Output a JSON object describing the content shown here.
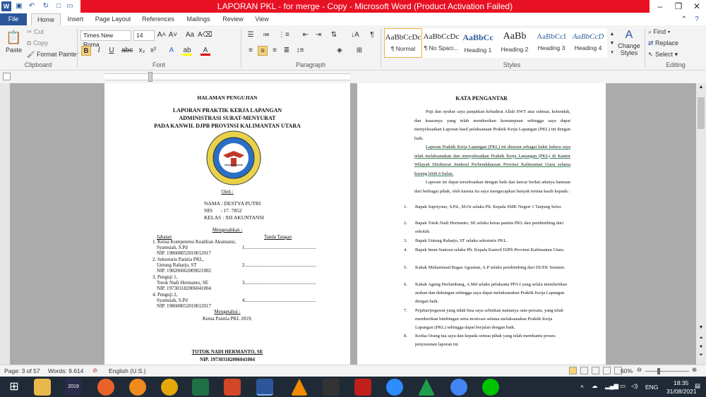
{
  "window": {
    "title": "LAPORAN PKL - for merge - Copy  -  Microsoft Word (Product Activation Failed)"
  },
  "tabs": [
    "File",
    "Home",
    "Insert",
    "Page Layout",
    "References",
    "Mailings",
    "Review",
    "View"
  ],
  "clipboard": {
    "paste": "Paste",
    "cut": "Cut",
    "copy": "Copy",
    "format_painter": "Format Painter",
    "label": "Clipboard"
  },
  "font": {
    "name": "Times New Roma",
    "size": "14",
    "label": "Font"
  },
  "paragraph": {
    "label": "Paragraph"
  },
  "styles": {
    "items": [
      {
        "preview": "AaBbCcDc",
        "name": "¶ Normal"
      },
      {
        "preview": "AaBbCcDc",
        "name": "¶ No Spaci..."
      },
      {
        "preview": "AaBbCc",
        "name": "Heading 1"
      },
      {
        "preview": "AaBb",
        "name": "Heading 2"
      },
      {
        "preview": "AaBbCcI",
        "name": "Heading 3"
      },
      {
        "preview": "AaBbCcD",
        "name": "Heading 4"
      }
    ],
    "change": "Change Styles",
    "label": "Styles"
  },
  "editing": {
    "find": "Find",
    "replace": "Replace",
    "select": "Select",
    "label": "Editing"
  },
  "page1": {
    "h1": "HALAMAN PENGUJIAN",
    "t1": "LAPORAN PRAKTIK  KERJA LAPANGAN",
    "t2": "ADMINISTRASI  SURAT-MENYURAT",
    "t3": "PADA KANWIL  DJPB PROVINSI KALIMANTAN  UTARA",
    "oleh": "Oleh :",
    "nama": "NAMA : DESTYA PUTRI",
    "nis": "NIS      : 17. 7852",
    "kelas": "KELAS : XII AKUNTANSI",
    "mengesahkan": "Mengesahkan :",
    "jabatan": "Jabatan",
    "tanda": "Tanda Tangan",
    "rows": [
      {
        "a": "1. Ketua Kompetensi Keahlian Akuntansi,",
        "b": "Syamsiah, S.Pd",
        "c": "NIP. 198608052010012017",
        "d": "1.........................................................."
      },
      {
        "a": "2. Sekretaris Panitia PKL,",
        "b": "Untung Raharjo, ST",
        "c": "NIP. 198206062009021002",
        "d": "2.........................................................."
      },
      {
        "a": "3. Penguji 1,",
        "b": "Totok Nadi Hermanto, SE",
        "c": "NIP. 197303182006041004",
        "d": "3.........................................................."
      },
      {
        "a": "4. Penguji 2,",
        "b": "Syamsiah, S.Pd",
        "c": "NIP. 198608052010012017",
        "d": "4.........................................................."
      }
    ],
    "mengetahui": "Mengetahui :",
    "ketua": "Ketua Panitia PKL 2019,",
    "sign_name": "TOTOK NADI HERMANTO, SE",
    "sign_nip": "NIP. 197303182006041004"
  },
  "page2": {
    "title": "KATA PENGANTAR",
    "p1": "Puji dan syukur saya panjatkan kehadirat Allah SWT atas rahmat, kehendak, dan kuasanya yang telah memberikan kemampuan sehingga saya dapat menyelesaikan Laporan hasil pelaksanaan Praktik Kerja Lapangan (PKL) ini dengan baik.",
    "p2": "Laporan Praktik Kerja Lapangan (PKL) ini disusun sebagai bukti bahwa saya telah melaksanakan dan menyelesaikan Praktik Kerja Lapangan (PKL) di Kantor Wilayah Direktorat Jenderal Perbendaharaan Provinsi Kalimantan Utara selama kurang lebih 6 bulan.",
    "p3": "Laporan ini dapat terselesaikan dengan baik dan lancar berkat adanya bantuan dari berbagai pihak, oleh karena itu saya mengucapkan banyak terima kasih kepada :",
    "items": [
      "Bapak Supriyono, S.Pd., M.Or selaku Plt. Kepala SMK Negeri 1 Tanjung Selor.",
      "Bapak Totok Nadi Hermanto, SE selaku ketua panitia PKL dan pembimbing dari  sekolah.",
      "Bapak Untung Raharjo, ST selaku sekretaris PKL.",
      "Bapak Iman Santosa selaku Plt. Kepala Kanwil DJPb Provinsi Kalimantan Utara.",
      "Kakak Muhammad Bagas Agustian, A.P selaku pembimbing dari DUDI/ Instansi.",
      "Kakak Agung Herlambang, A.Md selaku pelaksana PPA I yang selalu memberikan arahan dan dukungan sehingga saya dapat melaksanakan Praktik Kerja Lapangan dengan baik.",
      "Pejabat/pegawai yang tidak bisa saya sebutkan namanya satu-persatu, yang telah memberikan bimbingan serta motivasi selama melaksanakan Praktik Kerja Lapangan (PKL) sehingga dapat berjalan dengan baik.",
      "Kedua Orang tua saya dan kepada semua pihak yang telah membantu proses penyusunan laporan ini."
    ]
  },
  "status": {
    "page": "Page: 3 of 57",
    "words": "Words: 9.614",
    "lang": "English (U.S.)",
    "zoom": "60%"
  },
  "taskbar": {
    "lang": "ENG",
    "time": "18:35",
    "date": "31/08/2021"
  },
  "colors": {
    "word_blue": "#2b579a",
    "title_red": "#e81123",
    "taskbar": "#1f2a36"
  }
}
